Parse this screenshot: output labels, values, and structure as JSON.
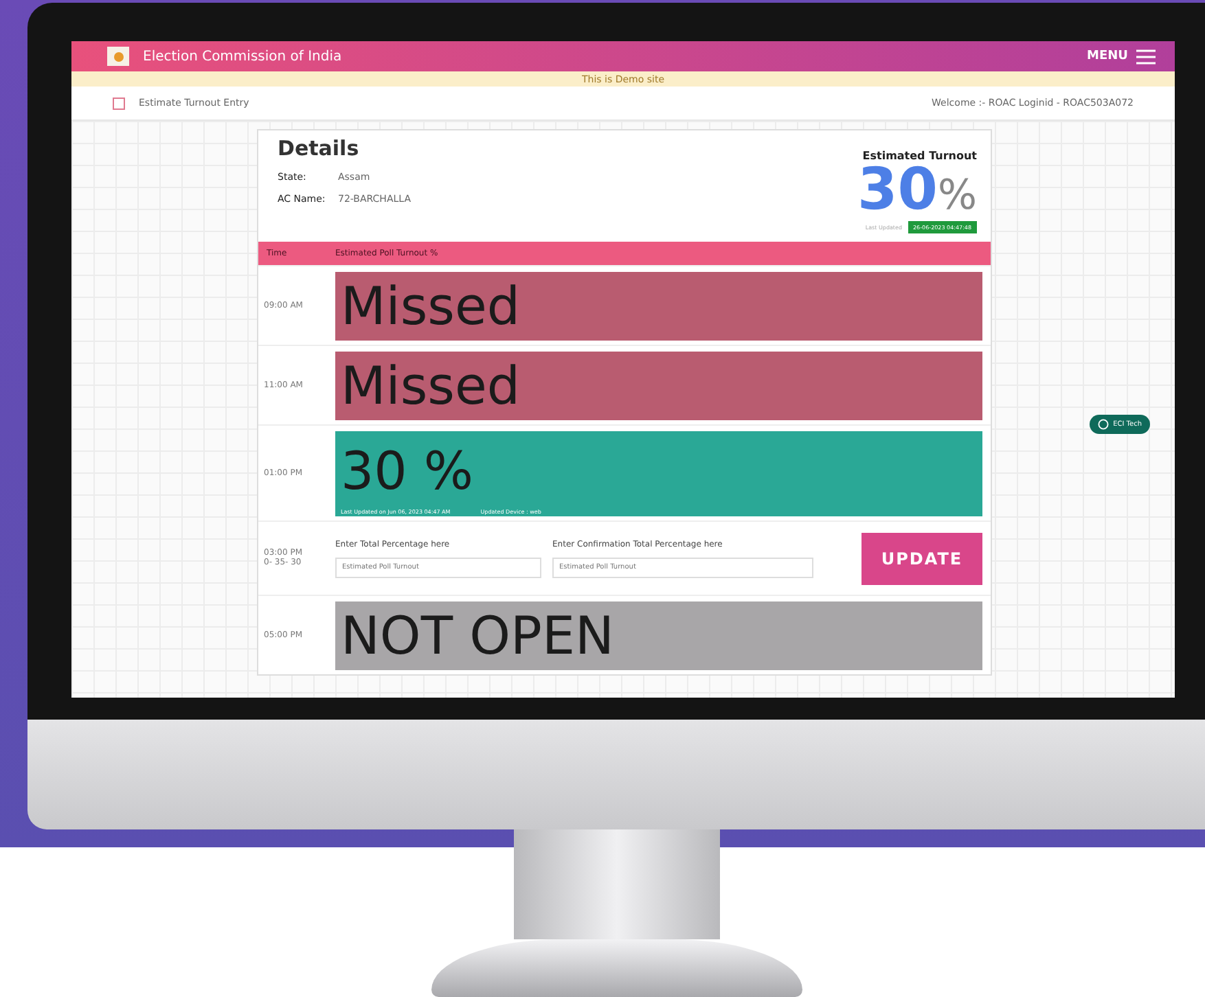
{
  "header": {
    "title": "Election Commission of India",
    "menu_label": "MENU"
  },
  "demo_notice": "This is Demo site",
  "breadcrumb": {
    "page": "Estimate Turnout Entry",
    "welcome": "Welcome :- ROAC Loginid - ROAC503A072"
  },
  "details": {
    "title": "Details",
    "fields": [
      {
        "label": "State:",
        "value": "Assam"
      },
      {
        "label": "AC Name:",
        "value": "72-BARCHALLA"
      }
    ]
  },
  "turnout": {
    "title": "Estimated Turnout",
    "value": "30",
    "unit": "%",
    "updated_label": "Last Updated",
    "updated_time": "26-06-2023 04:47:48"
  },
  "table": {
    "columns": [
      "Time",
      "Estimated Poll Turnout %"
    ],
    "rows": [
      {
        "time": "09:00 AM",
        "kind": "missed",
        "text": "Missed"
      },
      {
        "time": "11:00 AM",
        "kind": "missed",
        "text": "Missed"
      },
      {
        "time": "01:00 PM",
        "kind": "value",
        "text": "30 %",
        "note": "Last Updated on Jun 06, 2023 04:47 AM",
        "device": "Updated Device : web"
      },
      {
        "time": "03:00 PM",
        "time_range": "0- 35- 30",
        "kind": "entry",
        "field_label": "Enter Total Percentage here",
        "placeholder": "Estimated Poll Turnout",
        "confirm_label": "Enter Confirmation Total Percentage here",
        "confirm_placeholder": "Estimated Poll Turnout",
        "button": "UPDATE"
      },
      {
        "time": "05:00 PM",
        "kind": "not_open",
        "text": "NOT OPEN"
      }
    ]
  },
  "help_button": "ECI Tech"
}
